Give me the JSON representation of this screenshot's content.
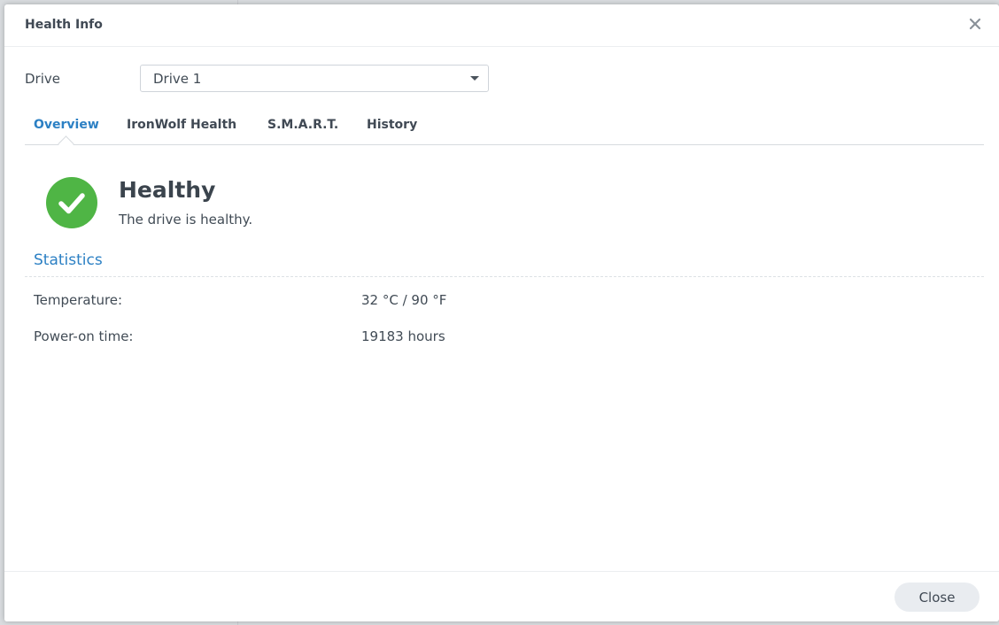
{
  "dialog": {
    "title": "Health Info",
    "close_icon": "close-icon"
  },
  "drive": {
    "label": "Drive",
    "selected": "Drive 1"
  },
  "tabs": [
    {
      "label": "Overview",
      "active": true
    },
    {
      "label": "IronWolf Health",
      "active": false
    },
    {
      "label": "S.M.A.R.T.",
      "active": false
    },
    {
      "label": "History",
      "active": false
    }
  ],
  "status": {
    "icon": "check-circle-icon",
    "title": "Healthy",
    "description": "The drive is healthy.",
    "color": "#4fb545"
  },
  "statistics": {
    "title": "Statistics",
    "rows": [
      {
        "label": "Temperature:",
        "value": "32 °C / 90 °F"
      },
      {
        "label": "Power-on time:",
        "value": "19183 hours"
      }
    ]
  },
  "footer": {
    "close_label": "Close"
  },
  "colors": {
    "accent": "#2c80c4",
    "text": "#414b55"
  }
}
